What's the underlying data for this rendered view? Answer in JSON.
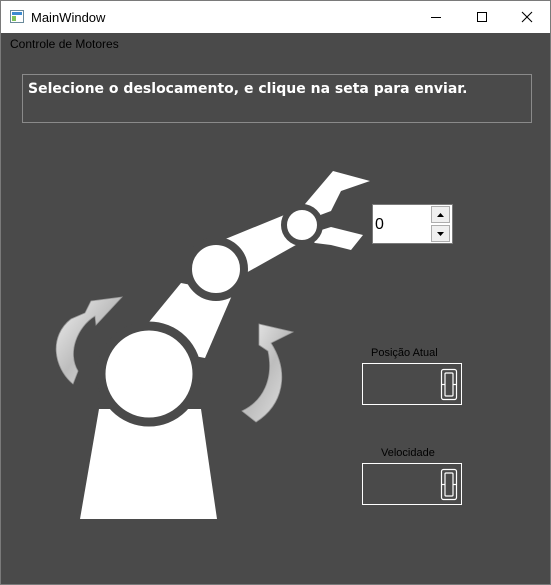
{
  "window": {
    "title": "MainWindow"
  },
  "menu": {
    "title": "Controle de Motores"
  },
  "instructions": {
    "text": "Selecione o deslocamento, e clique na seta para enviar."
  },
  "displacement": {
    "value": "0"
  },
  "position": {
    "label": "Posição Atual",
    "value": 0
  },
  "speed": {
    "label": "Velocidade",
    "value": 0
  },
  "icons": [
    "app-icon",
    "minimize-icon",
    "maximize-icon",
    "close-icon",
    "robot-arm-icon",
    "rotate-left-arrow-icon",
    "rotate-right-arrow-icon",
    "chevron-up-icon",
    "chevron-down-icon"
  ]
}
